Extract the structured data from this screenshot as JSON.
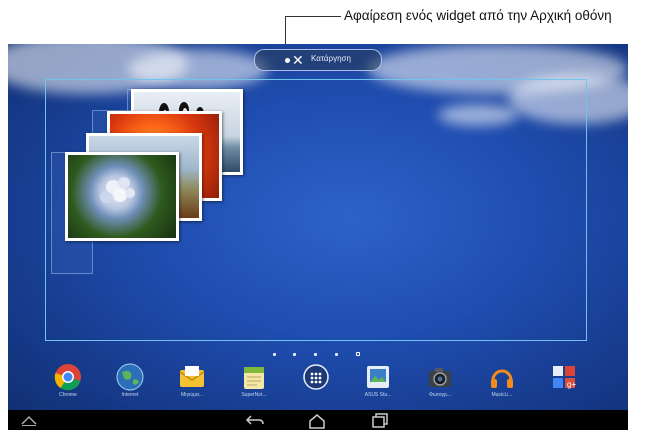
{
  "callout": {
    "text": "Αφαίρεση ενός widget από την Αρχική οθόνη"
  },
  "remove_bar": {
    "label": "Κατάργηση"
  },
  "page_indicator": {
    "count": 5,
    "active_index": 4
  },
  "dock": {
    "apps": [
      {
        "label": "Chrome",
        "icon": "chrome-icon"
      },
      {
        "label": "Internet",
        "icon": "globe-icon"
      },
      {
        "label": "Μηνύμα...",
        "icon": "email-icon"
      },
      {
        "label": "SuperNot...",
        "icon": "supernote-icon"
      },
      {
        "label": "",
        "icon": "app-drawer-icon"
      },
      {
        "label": "ASUS Stu...",
        "icon": "asus-studio-icon"
      },
      {
        "label": "Φωτογρ...",
        "icon": "camera-icon"
      },
      {
        "label": "MusicLi...",
        "icon": "headphones-icon"
      },
      {
        "label": "",
        "icon": "google-apps-folder-icon"
      }
    ]
  },
  "colors": {
    "accent": "#6fc4ee",
    "wallpaper": "#1f4db0",
    "navbar": "#000000"
  }
}
